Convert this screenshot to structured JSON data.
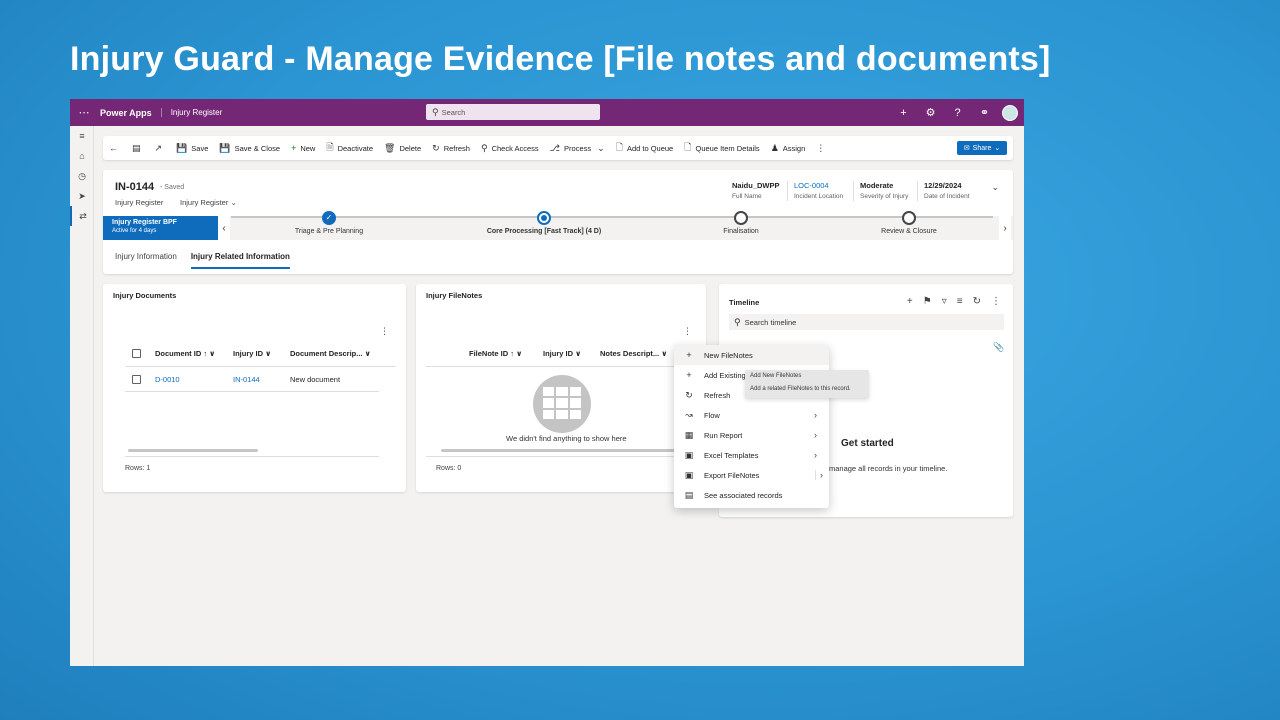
{
  "slide": {
    "title": "Injury Guard - Manage Evidence [File notes and documents]"
  },
  "topbar": {
    "brand": "Power Apps",
    "app_name": "Injury Register",
    "search_placeholder": "Search"
  },
  "commands": {
    "save": "Save",
    "save_close": "Save & Close",
    "new": "New",
    "deactivate": "Deactivate",
    "delete": "Delete",
    "refresh": "Refresh",
    "check_access": "Check Access",
    "process": "Process",
    "add_to_queue": "Add to Queue",
    "queue_item_details": "Queue Item Details",
    "assign": "Assign",
    "share": "Share"
  },
  "record": {
    "id": "IN-0144",
    "status": "- Saved",
    "entity": "Injury Register",
    "form": "Injury Register"
  },
  "header_fields": [
    {
      "value": "Naidu_DWPP",
      "label": "Full Name"
    },
    {
      "value": "LOC-0004",
      "label": "Incident Location"
    },
    {
      "value": "Moderate",
      "label": "Severity of Injury"
    },
    {
      "value": "12/29/2024",
      "label": "Date of Incident"
    }
  ],
  "bpf": {
    "name": "Injury Register BPF",
    "active": "Active for 4 days",
    "stages": [
      {
        "name": "Triage & Pre Planning",
        "state": "done"
      },
      {
        "name": "Core Processing [Fast Track]  (4 D)",
        "state": "current"
      },
      {
        "name": "Finalisation",
        "state": "todo"
      },
      {
        "name": "Review & Closure",
        "state": "todo"
      }
    ]
  },
  "tabs": [
    "Injury Information",
    "Injury Related Information"
  ],
  "documents": {
    "title": "Injury Documents",
    "columns": [
      "Document ID ↑ ∨",
      "Injury ID ∨",
      "Document Descrip... ∨"
    ],
    "rows": [
      {
        "doc_id": "D-0010",
        "injury_id": "IN-0144",
        "description": "New document"
      }
    ],
    "rows_label": "Rows: 1"
  },
  "filenotes": {
    "title": "Injury FileNotes",
    "columns": [
      "FileNote ID ↑ ∨",
      "Injury ID ∨",
      "Notes Descript... ∨"
    ],
    "empty_text": "We didn't find anything to show here",
    "rows_label": "Rows: 0"
  },
  "timeline": {
    "title": "Timeline",
    "search_placeholder": "Search timeline",
    "get_started": "Get started",
    "description": "manage all records in your timeline."
  },
  "context_menu": {
    "items": [
      {
        "label": "New FileNotes",
        "icon": "plus-icon"
      },
      {
        "label": "Add Existing",
        "icon": "plus-icon"
      },
      {
        "label": "Refresh",
        "icon": "refresh-icon"
      },
      {
        "label": "Flow",
        "icon": "flow-icon"
      },
      {
        "label": "Run Report",
        "icon": "report-icon"
      },
      {
        "label": "Excel Templates",
        "icon": "excel-icon"
      },
      {
        "label": "Export FileNotes",
        "icon": "excel-icon"
      },
      {
        "label": "See associated records",
        "icon": "records-icon"
      }
    ]
  },
  "tooltip": {
    "title": "Add New FileNotes",
    "description": "Add a related FileNotes to this record."
  },
  "colors": {
    "topbar": "#742774",
    "accent": "#0f6cbd",
    "slide_bg": "#2f9ad6"
  }
}
